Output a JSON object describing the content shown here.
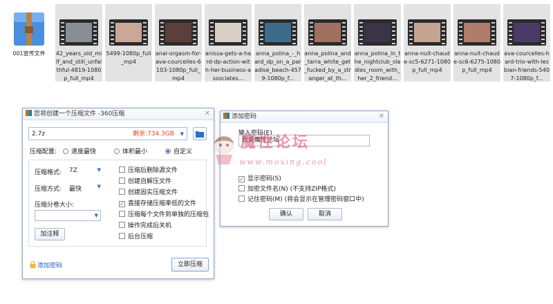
{
  "files": [
    {
      "name": "001宣传文件",
      "type": "archive"
    },
    {
      "name": "42_years_old_milf_and_still_unfaithful-4819-1080p_full_mp4",
      "type": "video",
      "color": "#8a8f96"
    },
    {
      "name": "5499-1080p_full_mp4",
      "type": "video",
      "color": "#c9a89a"
    },
    {
      "name": "anal-orgasm-for-ava-courcelles-6103-1080p_full_mp4",
      "type": "video",
      "color": "#5a4038"
    },
    {
      "name": "anissa-gets-a-hard-dp-action-with-her-business-associates...",
      "type": "video",
      "color": "#d8cfc6"
    },
    {
      "name": "anna_polina_-_hard_dp_on_a_paradise_beach-4579-1080p_f...",
      "type": "video",
      "color": "#3d6b8a"
    },
    {
      "name": "anna_polina_and_tarra_white_get_fucked_by_a_stranger_at_th...",
      "type": "video",
      "color": "#a07060"
    },
    {
      "name": "anna_polina_in_the_nightclub_sladies_room_with_her_2_friend...",
      "type": "video",
      "color": "#3a3446"
    },
    {
      "name": "anna-nuit-chaude-sc5-6271-1080p_full_mp4",
      "type": "video",
      "color": "#c4a493"
    },
    {
      "name": "anna-nuit-chaude-sc6-6275-1080p_full_mp4",
      "type": "video",
      "color": "#b07c6c"
    },
    {
      "name": "ava-courcelles-hard-trio-with-lesbian-friends-5407-1080p_f...",
      "type": "video",
      "color": "#4a3a66"
    }
  ],
  "compress_dialog": {
    "title": "您将创建一个压缩文件 -360压缩",
    "filename": "2.7z",
    "space_left": "剩余:734.3GB",
    "config_label": "压缩配置:",
    "modes": [
      {
        "label": "速度最快",
        "selected": false
      },
      {
        "label": "体积最小",
        "selected": false
      },
      {
        "label": "自定义",
        "selected": true
      }
    ],
    "format_label": "压缩格式:",
    "format_value": "7Z",
    "method_label": "压缩方式:",
    "method_value": "最快",
    "split_label": "压缩分卷大小:",
    "split_value": "",
    "comment_button": "加注释",
    "options": [
      {
        "label": "压缩后删除源文件",
        "checked": false
      },
      {
        "label": "创建自解压文件",
        "checked": false
      },
      {
        "label": "创建固实压缩文件",
        "checked": false
      },
      {
        "label": "直接存储压缩率低的文件",
        "checked": true
      },
      {
        "label": "压缩每个文件到单独的压缩包",
        "checked": false
      },
      {
        "label": "操作完成后关机",
        "checked": false
      },
      {
        "label": "后台压缩",
        "checked": false
      }
    ],
    "add_password_link": "添加密码",
    "compress_button": "立即压缩"
  },
  "password_dialog": {
    "title": "添加密码",
    "input_label": "输入密码(E)",
    "password_value": "我爱魔性论坛",
    "options": [
      {
        "label": "显示密码(S)",
        "checked": true
      },
      {
        "label": "加密文件名(N) (不支持ZIP格式)",
        "checked": false
      },
      {
        "label": "记住密码(M) (将会显示在管理密码窗口中)",
        "checked": false
      }
    ],
    "ok_button": "确认",
    "cancel_button": "取消"
  },
  "watermark": {
    "title": "魔性论坛",
    "url": "www.moxing.cool"
  },
  "colors": {
    "accent": "#2b6fd0",
    "space_left": "#e0461e",
    "link": "#1f5fbf",
    "watermark": "#e0607e"
  }
}
